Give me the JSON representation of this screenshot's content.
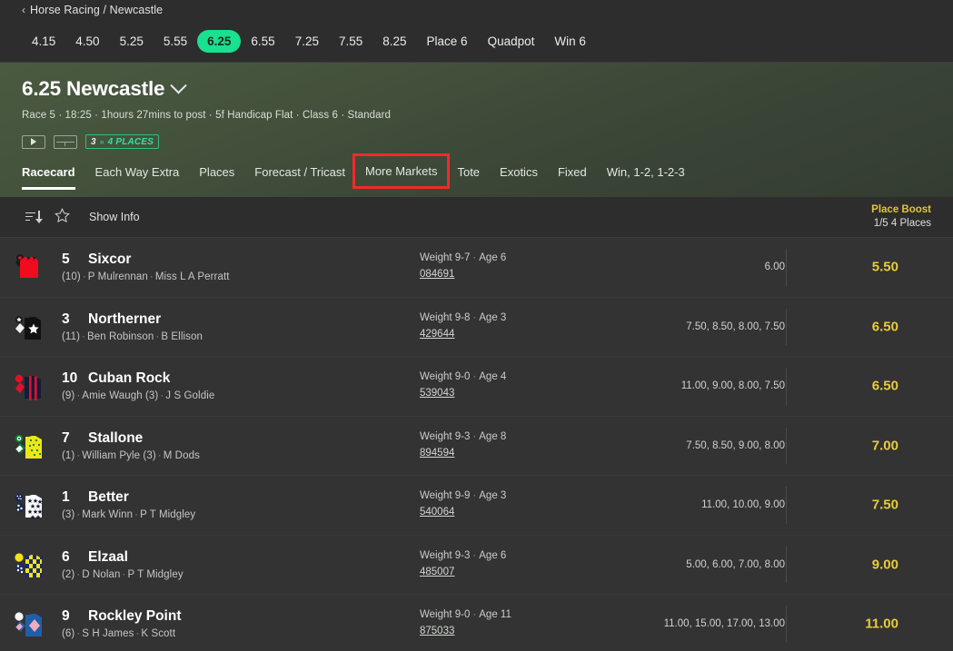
{
  "breadcrumb": {
    "back_icon": "chevron-left-icon",
    "text": "Horse Racing / Newcastle"
  },
  "race_times": [
    {
      "label": "4.15",
      "active": false
    },
    {
      "label": "4.50",
      "active": false
    },
    {
      "label": "5.25",
      "active": false
    },
    {
      "label": "5.55",
      "active": false
    },
    {
      "label": "6.25",
      "active": true
    },
    {
      "label": "6.55",
      "active": false
    },
    {
      "label": "7.25",
      "active": false
    },
    {
      "label": "7.55",
      "active": false
    },
    {
      "label": "8.25",
      "active": false
    },
    {
      "label": "Place 6",
      "active": false
    },
    {
      "label": "Quadpot",
      "active": false
    },
    {
      "label": "Win 6",
      "active": false
    }
  ],
  "race_header": {
    "title": "6.25 Newcastle",
    "meta": "Race 5 · 18:25 · 1hours 27mins to post · 5f Handicap Flat · Class 6 · Standard",
    "video_icon": "play-icon",
    "form_icon": "form-guide-icon",
    "places_badge": {
      "number": "3",
      "arrow": "»",
      "label": "4 PLACES"
    }
  },
  "tabs": [
    {
      "label": "Racecard",
      "active": true,
      "highlight": false
    },
    {
      "label": "Each Way Extra",
      "active": false,
      "highlight": false
    },
    {
      "label": "Places",
      "active": false,
      "highlight": false
    },
    {
      "label": "Forecast / Tricast",
      "active": false,
      "highlight": false
    },
    {
      "label": "More Markets",
      "active": false,
      "highlight": true
    },
    {
      "label": "Tote",
      "active": false,
      "highlight": false
    },
    {
      "label": "Exotics",
      "active": false,
      "highlight": false
    },
    {
      "label": "Fixed",
      "active": false,
      "highlight": false
    },
    {
      "label": "Win, 1-2, 1-2-3",
      "active": false,
      "highlight": false
    }
  ],
  "toolbar": {
    "sort_icon": "sort-descending-icon",
    "star_icon": "star-outline-icon",
    "show_info_label": "Show Info",
    "place_boost_title": "Place Boost",
    "place_boost_terms": "1/5 4 Places"
  },
  "highlight_color": "#ee2b2b",
  "accent_color": "#19e18f",
  "odds_color": "#e8cb3c",
  "runners": [
    {
      "number": "5",
      "name": "Sixcor",
      "draw": "(10)",
      "jockey": "P Mulrennan",
      "trainer": "Miss L A Perratt",
      "weight": "Weight 9-7",
      "age": "Age 6",
      "form": "084691",
      "prices": "6.00",
      "odds": "5.50",
      "silk": "red-body-white-sleeve"
    },
    {
      "number": "3",
      "name": "Northerner",
      "draw": "(11)",
      "jockey": "Ben Robinson",
      "trainer": "B Ellison",
      "weight": "Weight 9-8",
      "age": "Age 3",
      "form": "429644",
      "prices": "7.50, 8.50, 8.00, 7.50",
      "odds": "6.50",
      "silk": "black-star"
    },
    {
      "number": "10",
      "name": "Cuban Rock",
      "draw": "(9)",
      "jockey": "Amie Waugh (3)",
      "trainer": "J S Goldie",
      "weight": "Weight 9-0",
      "age": "Age 4",
      "form": "539043",
      "prices": "11.00, 9.00, 8.00, 7.50",
      "odds": "6.50",
      "silk": "navy-red-stripe"
    },
    {
      "number": "7",
      "name": "Stallone",
      "draw": "(1)",
      "jockey": "William Pyle (3)",
      "trainer": "M Dods",
      "weight": "Weight 9-3",
      "age": "Age 8",
      "form": "894594",
      "prices": "7.50, 8.50, 9.00, 8.00",
      "odds": "7.00",
      "silk": "yellow-green-spots"
    },
    {
      "number": "1",
      "name": "Better",
      "draw": "(3)",
      "jockey": "Mark Winn",
      "trainer": "P T Midgley",
      "weight": "Weight 9-9",
      "age": "Age 3",
      "form": "540064",
      "prices": "11.00, 10.00, 9.00",
      "odds": "7.50",
      "silk": "white-navy-stars"
    },
    {
      "number": "6",
      "name": "Elzaal",
      "draw": "(2)",
      "jockey": "D Nolan",
      "trainer": "P T Midgley",
      "weight": "Weight 9-3",
      "age": "Age 6",
      "form": "485007",
      "prices": "5.00, 6.00, 7.00, 8.00",
      "odds": "9.00",
      "silk": "yellow-blue-check"
    },
    {
      "number": "9",
      "name": "Rockley Point",
      "draw": "(6)",
      "jockey": "S H James",
      "trainer": "K Scott",
      "weight": "Weight 9-0",
      "age": "Age 11",
      "form": "875033",
      "prices": "11.00, 15.00, 17.00, 13.00",
      "odds": "11.00",
      "silk": "blue-pink-diamond"
    }
  ]
}
